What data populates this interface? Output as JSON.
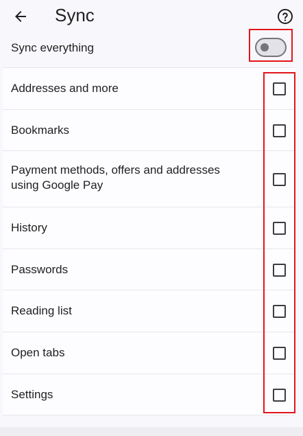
{
  "header": {
    "title": "Sync",
    "back_icon": "arrow-back-icon",
    "help_icon": "help-circle-icon"
  },
  "sync_everything": {
    "label": "Sync everything",
    "enabled": false
  },
  "items": [
    {
      "label": "Addresses and more",
      "checked": false
    },
    {
      "label": "Bookmarks",
      "checked": false
    },
    {
      "label": "Payment methods, offers and addresses using Google Pay",
      "checked": false
    },
    {
      "label": "History",
      "checked": false
    },
    {
      "label": "Passwords",
      "checked": false
    },
    {
      "label": "Reading list",
      "checked": false
    },
    {
      "label": "Open tabs",
      "checked": false
    },
    {
      "label": "Settings",
      "checked": false
    }
  ],
  "colors": {
    "highlight": "#e3141c",
    "background": "#f8f7fb",
    "toggle_off": "#757478"
  }
}
